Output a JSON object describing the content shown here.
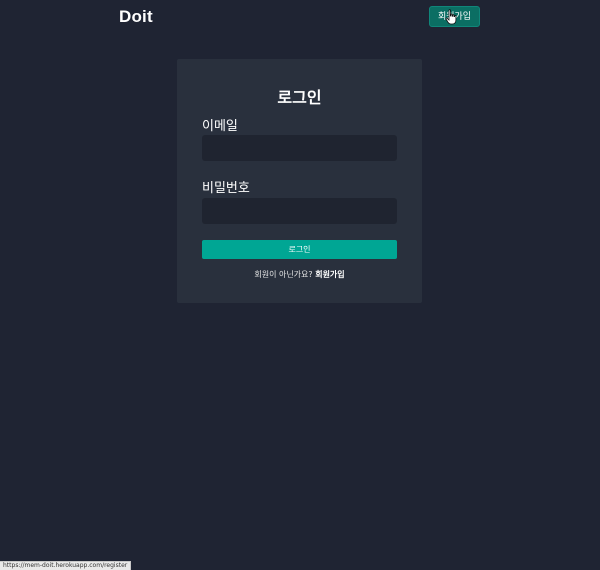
{
  "header": {
    "logo": "Doit",
    "signup_button": "회원가입"
  },
  "login_card": {
    "title": "로그인",
    "email_label": "이메일",
    "email_value": "",
    "password_label": "비밀번호",
    "password_value": "",
    "submit_label": "로그인",
    "prompt_text": "회원이 아닌가요?",
    "signup_link": "회원가입"
  },
  "status_bar": {
    "url": "https://mem-doit.herokuapp.com/register"
  },
  "colors": {
    "background": "#1f2433",
    "card": "#29303d",
    "input": "#1f2430",
    "accent": "#00a694",
    "header_button": "#0b6e63"
  },
  "icons": {
    "cursor": "hand-pointer-icon"
  }
}
